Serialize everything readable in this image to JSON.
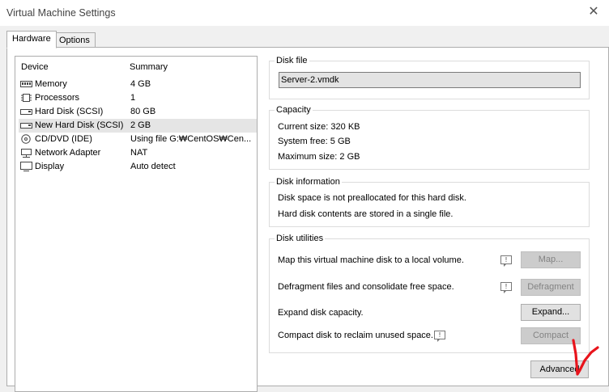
{
  "window": {
    "title": "Virtual Machine Settings",
    "close_glyph": "✕"
  },
  "tabs": [
    {
      "label": "Hardware"
    },
    {
      "label": "Options"
    }
  ],
  "devices": {
    "col_device": "Device",
    "col_summary": "Summary",
    "items": [
      {
        "name": "Memory",
        "summary": "4 GB",
        "icon": "memory-icon"
      },
      {
        "name": "Processors",
        "summary": "1",
        "icon": "processor-icon"
      },
      {
        "name": "Hard Disk (SCSI)",
        "summary": "80 GB",
        "icon": "hard-disk-icon"
      },
      {
        "name": "New Hard Disk (SCSI)",
        "summary": "2 GB",
        "icon": "hard-disk-icon"
      },
      {
        "name": "CD/DVD (IDE)",
        "summary": "Using file G:₩CentOS₩Cen...",
        "icon": "cd-dvd-icon"
      },
      {
        "name": "Network Adapter",
        "summary": "NAT",
        "icon": "network-adapter-icon"
      },
      {
        "name": "Display",
        "summary": "Auto detect",
        "icon": "display-icon"
      }
    ]
  },
  "disk_file": {
    "legend": "Disk file",
    "value": "Server-2.vmdk"
  },
  "capacity": {
    "legend": "Capacity",
    "current_size": "Current size:  320 KB",
    "system_free": "System free:  5 GB",
    "maximum_size": "Maximum size:  2 GB"
  },
  "disk_information": {
    "legend": "Disk information",
    "line1": "Disk space is not preallocated for this hard disk.",
    "line2": "Hard disk contents are stored in a single file."
  },
  "disk_utilities": {
    "legend": "Disk utilities",
    "map_text": "Map this virtual machine disk to a local volume.",
    "map_button": "Map...",
    "defrag_text": "Defragment files and consolidate free space.",
    "defrag_button": "Defragment",
    "expand_text": "Expand disk capacity.",
    "expand_button": "Expand...",
    "compact_text": "Compact disk to reclaim unused space.",
    "compact_button": "Compact"
  },
  "advanced_button": "Advanced",
  "info_glyph": "!",
  "colors": {
    "annotation_red": "#e8141c",
    "selected_row": "#e5e5e5"
  }
}
